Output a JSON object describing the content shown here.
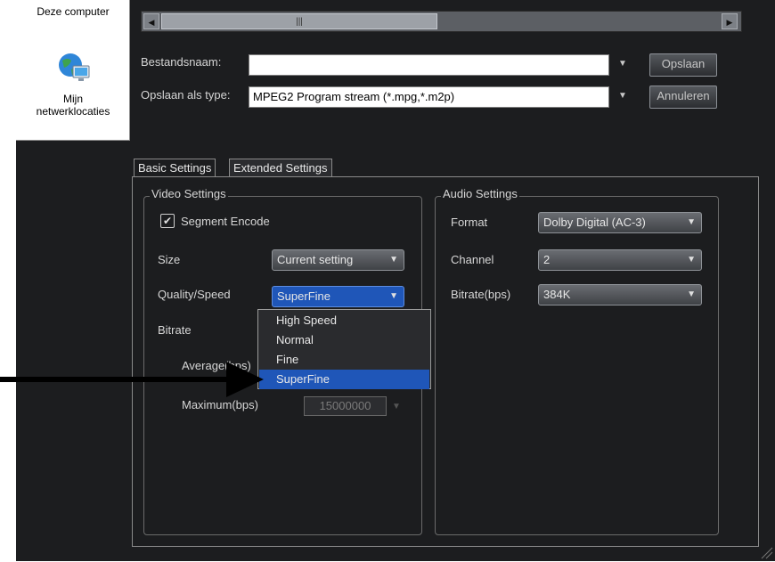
{
  "places": {
    "computer_label": "Deze computer",
    "network_label_line1": "Mijn",
    "network_label_line2": "netwerklocaties"
  },
  "save_dialog": {
    "filename_label": "Bestandsnaam:",
    "filename_value": "",
    "filetype_label": "Opslaan als type:",
    "filetype_value": "MPEG2 Program stream (*.mpg,*.m2p)",
    "save_button": "Opslaan",
    "cancel_button": "Annuleren",
    "scroll_thumb_glyph": "|||"
  },
  "tabs": {
    "basic": "Basic Settings",
    "extended": "Extended Settings"
  },
  "video": {
    "title": "Video Settings",
    "segment_encode": "Segment Encode",
    "size_label": "Size",
    "size_value": "Current setting",
    "quality_label": "Quality/Speed",
    "quality_value": "SuperFine",
    "bitrate_label": "Bitrate",
    "average_label": "Average(bps)",
    "maximum_label": "Maximum(bps)",
    "maximum_value": "15000000",
    "quality_options": [
      "High Speed",
      "Normal",
      "Fine",
      "SuperFine"
    ]
  },
  "audio": {
    "title": "Audio Settings",
    "format_label": "Format",
    "format_value": "Dolby Digital (AC-3)",
    "channel_label": "Channel",
    "channel_value": "2",
    "bitrate_label": "Bitrate(bps)",
    "bitrate_value": "384K"
  },
  "colors": {
    "window_bg": "#1c1d1f",
    "highlight": "#1f56b8",
    "annotation_arrow": "#000000"
  }
}
